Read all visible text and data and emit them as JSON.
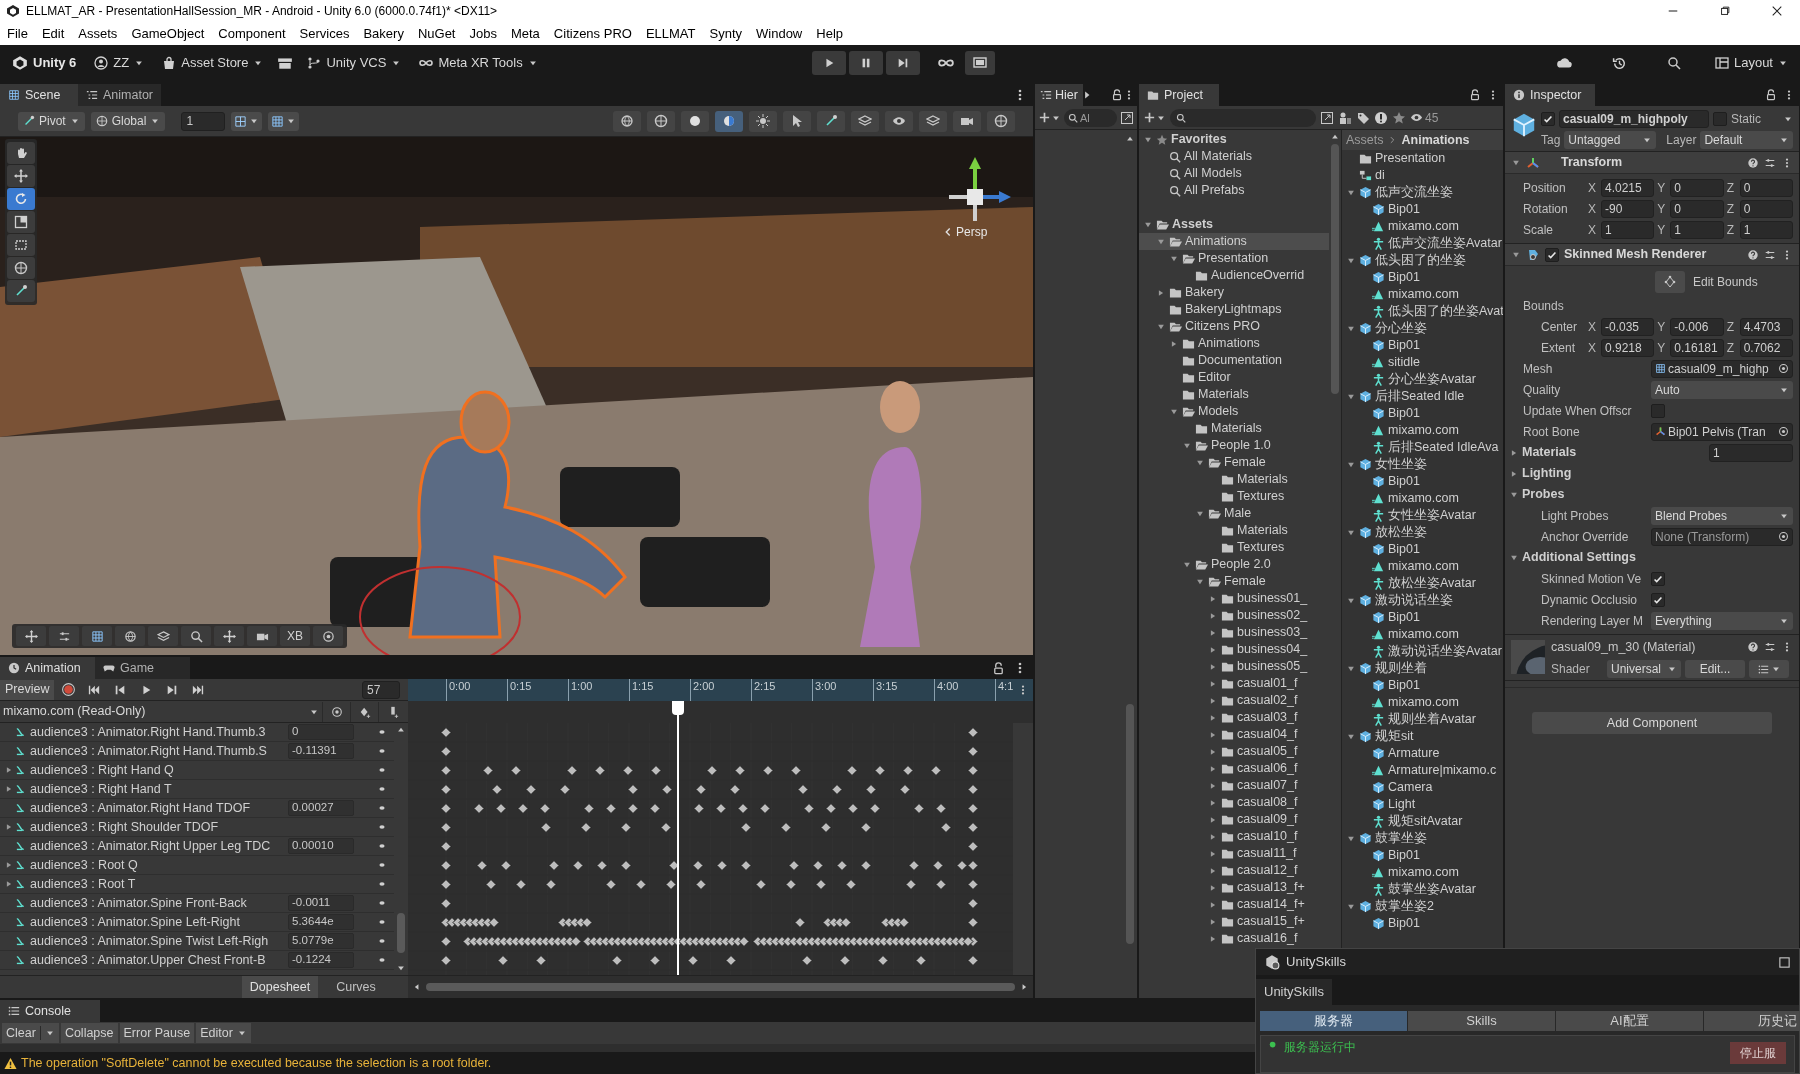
{
  "window": {
    "title": "ELLMAT_AR - PresentationHallSession_MR - Android - Unity 6.0 (6000.0.74f1)* <DX11>"
  },
  "menu": [
    "File",
    "Edit",
    "Assets",
    "GameObject",
    "Component",
    "Services",
    "Bakery",
    "NuGet",
    "Jobs",
    "Meta",
    "Citizens PRO",
    "ELLMAT",
    "Synty",
    "Window",
    "Help"
  ],
  "toolbar": {
    "product": "Unity 6",
    "account": "ZZ",
    "asset_store": "Asset Store",
    "vcs": "Unity VCS",
    "meta": "Meta XR Tools",
    "layout": "Layout"
  },
  "scene": {
    "tabs": [
      {
        "label": "Scene",
        "selected": true
      },
      {
        "label": "Animator",
        "selected": false
      }
    ],
    "pivot": "Pivot",
    "space": "Global",
    "grid_value": "1",
    "projection": "Persp",
    "overlay_label": "XB",
    "tools": [
      {
        "kind": "view",
        "selected": false
      },
      {
        "kind": "move",
        "selected": false
      },
      {
        "kind": "rotate",
        "selected": true
      },
      {
        "kind": "scale",
        "selected": false
      },
      {
        "kind": "rect",
        "selected": false
      },
      {
        "kind": "transform",
        "selected": false
      },
      {
        "kind": "custom",
        "selected": false
      }
    ]
  },
  "animation": {
    "tabs": [
      {
        "label": "Animation",
        "selected": true
      },
      {
        "label": "Game",
        "selected": false
      }
    ],
    "preview": "Preview",
    "frame": "57",
    "clip": "mixamo.com (Read-Only)",
    "ticks": [
      "0:00",
      "0:15",
      "1:00",
      "1:15",
      "2:00",
      "2:15",
      "3:00",
      "3:15",
      "4:00",
      "4:1"
    ],
    "properties": [
      {
        "name": "audience3 : Animator.Right Hand.Thumb.3",
        "value": "0",
        "expandable": false
      },
      {
        "name": "audience3 : Animator.Right Hand.Thumb.S",
        "value": "-0.11391",
        "expandable": false
      },
      {
        "name": "audience3 : Right Hand Q",
        "expandable": true
      },
      {
        "name": "audience3 : Right Hand T",
        "expandable": true
      },
      {
        "name": "audience3 : Animator.Right Hand TDOF",
        "value": "0.00027",
        "expandable": false
      },
      {
        "name": "audience3 : Right Shoulder TDOF",
        "expandable": true
      },
      {
        "name": "audience3 : Animator.Right Upper Leg TDC",
        "value": "0.00010",
        "expandable": false
      },
      {
        "name": "audience3 : Root Q",
        "expandable": true
      },
      {
        "name": "audience3 : Root T",
        "expandable": true
      },
      {
        "name": "audience3 : Animator.Spine Front-Back",
        "value": "-0.0011",
        "expandable": false
      },
      {
        "name": "audience3 : Animator.Spine Left-Right",
        "value": "5.3644e",
        "expandable": false
      },
      {
        "name": "audience3 : Animator.Spine Twist Left-Righ",
        "value": "5.0779e",
        "expandable": false
      },
      {
        "name": "audience3 : Animator.Upper Chest Front-B",
        "value": "-0.1224",
        "expandable": false
      }
    ],
    "views": [
      {
        "label": "Dopesheet",
        "selected": true
      },
      {
        "label": "Curves",
        "selected": false
      }
    ]
  },
  "hierarchy": {
    "tab": "Hier",
    "search_placeholder": "Al"
  },
  "project": {
    "tab": "Project",
    "count": "45",
    "favorites": {
      "label": "Favorites",
      "expanded": true,
      "items": [
        "All Materials",
        "All Models",
        "All Prefabs"
      ]
    },
    "tree": [
      {
        "label": "Assets",
        "expanded": true,
        "selected": false,
        "children": [
          {
            "label": "Animations",
            "expanded": true,
            "selected": true,
            "children": [
              {
                "label": "Presentation",
                "expanded": true,
                "selected": false,
                "children": [
                  {
                    "label": "AudienceOverrid",
                    "selected": false
                  }
                ]
              }
            ]
          },
          {
            "label": "Bakery",
            "expanded": false,
            "selected": false
          },
          {
            "label": "BakeryLightmaps",
            "selected": false
          },
          {
            "label": "Citizens PRO",
            "expanded": true,
            "selected": false,
            "children": [
              {
                "label": "Animations",
                "expanded": false,
                "selected": false
              },
              {
                "label": "Documentation",
                "selected": false
              },
              {
                "label": "Editor",
                "selected": false
              },
              {
                "label": "Materials",
                "selected": false
              },
              {
                "label": "Models",
                "expanded": true,
                "selected": false,
                "children": [
                  {
                    "label": "Materials",
                    "selected": false
                  },
                  {
                    "label": "People 1.0",
                    "expanded": true,
                    "selected": false,
                    "children": [
                      {
                        "label": "Female",
                        "expanded": true,
                        "selected": false,
                        "children": [
                          {
                            "label": "Materials",
                            "selected": false
                          },
                          {
                            "label": "Textures",
                            "selected": false
                          }
                        ]
                      },
                      {
                        "label": "Male",
                        "expanded": true,
                        "selected": false,
                        "children": [
                          {
                            "label": "Materials",
                            "selected": false
                          },
                          {
                            "label": "Textures",
                            "selected": false
                          }
                        ]
                      }
                    ]
                  },
                  {
                    "label": "People 2.0",
                    "expanded": true,
                    "selected": false,
                    "children": [
                      {
                        "label": "Female",
                        "expanded": true,
                        "selected": false,
                        "children": [
                          {
                            "label": "business01_",
                            "expanded": false,
                            "selected": false
                          },
                          {
                            "label": "business02_",
                            "expanded": false,
                            "selected": false
                          },
                          {
                            "label": "business03_",
                            "expanded": false,
                            "selected": false
                          },
                          {
                            "label": "business04_",
                            "expanded": false,
                            "selected": false
                          },
                          {
                            "label": "business05_",
                            "expanded": false,
                            "selected": false
                          },
                          {
                            "label": "casual01_f",
                            "expanded": false,
                            "selected": false
                          },
                          {
                            "label": "casual02_f",
                            "expanded": false,
                            "selected": false
                          },
                          {
                            "label": "casual03_f",
                            "expanded": false,
                            "selected": false
                          },
                          {
                            "label": "casual04_f",
                            "expanded": false,
                            "selected": false
                          },
                          {
                            "label": "casual05_f",
                            "expanded": false,
                            "selected": false
                          },
                          {
                            "label": "casual06_f",
                            "expanded": false,
                            "selected": false
                          },
                          {
                            "label": "casual07_f",
                            "expanded": false,
                            "selected": false
                          },
                          {
                            "label": "casual08_f",
                            "expanded": false,
                            "selected": false
                          },
                          {
                            "label": "casual09_f",
                            "expanded": false,
                            "selected": false
                          },
                          {
                            "label": "casual10_f",
                            "expanded": false,
                            "selected": false
                          },
                          {
                            "label": "casual11_f",
                            "expanded": false,
                            "selected": false
                          },
                          {
                            "label": "casual12_f",
                            "expanded": false,
                            "selected": false
                          },
                          {
                            "label": "casual13_f+",
                            "expanded": false,
                            "selected": false
                          },
                          {
                            "label": "casual14_f+",
                            "expanded": false,
                            "selected": false
                          },
                          {
                            "label": "casual15_f+",
                            "expanded": false,
                            "selected": false
                          },
                          {
                            "label": "casual16_f",
                            "expanded": false,
                            "selected": false
                          }
                        ]
                      }
                    ]
                  }
                ]
              }
            ]
          }
        ]
      }
    ],
    "breadcrumb": [
      "Assets",
      "Animations"
    ],
    "assets": [
      {
        "label": "Presentation",
        "kind": "folder"
      },
      {
        "label": "di",
        "kind": "controller"
      },
      {
        "label": "低声交流坐姿",
        "kind": "model",
        "expanded": true,
        "children": [
          {
            "label": "Bip01",
            "kind": "model"
          },
          {
            "label": "mixamo.com",
            "kind": "clip"
          },
          {
            "label": "低声交流坐姿Avatar",
            "kind": "avatar"
          }
        ]
      },
      {
        "label": "低头困了的坐姿",
        "kind": "model",
        "expanded": true,
        "children": [
          {
            "label": "Bip01",
            "kind": "model"
          },
          {
            "label": "mixamo.com",
            "kind": "clip"
          },
          {
            "label": "低头困了的坐姿Avat",
            "kind": "avatar"
          }
        ]
      },
      {
        "label": "分心坐姿",
        "kind": "model",
        "expanded": true,
        "children": [
          {
            "label": "Bip01",
            "kind": "model"
          },
          {
            "label": "sitidle",
            "kind": "clip"
          },
          {
            "label": "分心坐姿Avatar",
            "kind": "avatar"
          }
        ]
      },
      {
        "label": "后排Seated Idle",
        "kind": "model",
        "expanded": true,
        "children": [
          {
            "label": "Bip01",
            "kind": "model"
          },
          {
            "label": "mixamo.com",
            "kind": "clip"
          },
          {
            "label": "后排Seated IdleAva",
            "kind": "avatar"
          }
        ]
      },
      {
        "label": "女性坐姿",
        "kind": "model",
        "expanded": true,
        "children": [
          {
            "label": "Bip01",
            "kind": "model"
          },
          {
            "label": "mixamo.com",
            "kind": "clip"
          },
          {
            "label": "女性坐姿Avatar",
            "kind": "avatar"
          }
        ]
      },
      {
        "label": "放松坐姿",
        "kind": "model",
        "expanded": true,
        "children": [
          {
            "label": "Bip01",
            "kind": "model"
          },
          {
            "label": "mixamo.com",
            "kind": "clip"
          },
          {
            "label": "放松坐姿Avatar",
            "kind": "avatar"
          }
        ]
      },
      {
        "label": "激动说话坐姿",
        "kind": "model",
        "expanded": true,
        "children": [
          {
            "label": "Bip01",
            "kind": "model"
          },
          {
            "label": "mixamo.com",
            "kind": "clip"
          },
          {
            "label": "激动说话坐姿Avatar",
            "kind": "avatar"
          }
        ]
      },
      {
        "label": "规则坐着",
        "kind": "model",
        "expanded": true,
        "children": [
          {
            "label": "Bip01",
            "kind": "model"
          },
          {
            "label": "mixamo.com",
            "kind": "clip"
          },
          {
            "label": "规则坐着Avatar",
            "kind": "avatar"
          }
        ]
      },
      {
        "label": "规矩sit",
        "kind": "model",
        "expanded": true,
        "children": [
          {
            "label": "Armature",
            "kind": "model"
          },
          {
            "label": "Armature|mixamo.c",
            "kind": "clip"
          },
          {
            "label": "Camera",
            "kind": "model"
          },
          {
            "label": "Light",
            "kind": "model"
          },
          {
            "label": "规矩sitAvatar",
            "kind": "avatar"
          }
        ]
      },
      {
        "label": "鼓掌坐姿",
        "kind": "model",
        "expanded": true,
        "children": [
          {
            "label": "Bip01",
            "kind": "model"
          },
          {
            "label": "mixamo.com",
            "kind": "clip"
          },
          {
            "label": "鼓掌坐姿Avatar",
            "kind": "avatar"
          }
        ]
      },
      {
        "label": "鼓掌坐姿2",
        "kind": "model",
        "expanded": true,
        "children": [
          {
            "label": "Bip01",
            "kind": "model"
          }
        ]
      }
    ]
  },
  "inspector": {
    "tab": "Inspector",
    "object": {
      "name": "casual09_m_highpoly",
      "active": true,
      "static": false,
      "static_label": "Static",
      "tag_label": "Tag",
      "tag": "Untagged",
      "layer_label": "Layer",
      "layer": "Default"
    },
    "transform": {
      "title": "Transform",
      "expanded": true,
      "rows": [
        {
          "label": "Position",
          "fields": [
            {
              "axis": "X",
              "value": "4.0215"
            },
            {
              "axis": "Y",
              "value": "0"
            },
            {
              "axis": "Z",
              "value": "0"
            }
          ]
        },
        {
          "label": "Rotation",
          "fields": [
            {
              "axis": "X",
              "value": "-90"
            },
            {
              "axis": "Y",
              "value": "0"
            },
            {
              "axis": "Z",
              "value": "0"
            }
          ]
        },
        {
          "label": "Scale",
          "fields": [
            {
              "axis": "X",
              "value": "1"
            },
            {
              "axis": "Y",
              "value": "1"
            },
            {
              "axis": "Z",
              "value": "1"
            }
          ]
        }
      ]
    },
    "skinned_mesh_renderer": {
      "title": "Skinned Mesh Renderer",
      "enabled": true,
      "expanded": true,
      "edit_bounds": "Edit Bounds",
      "bounds_label": "Bounds",
      "bounds": [
        {
          "label": "Center",
          "fields": [
            {
              "axis": "X",
              "value": "-0.035"
            },
            {
              "axis": "Y",
              "value": "-0.006"
            },
            {
              "axis": "Z",
              "value": "4.4703"
            }
          ]
        },
        {
          "label": "Extent",
          "fields": [
            {
              "axis": "X",
              "value": "0.9218"
            },
            {
              "axis": "Y",
              "value": "0.16181"
            },
            {
              "axis": "Z",
              "value": "0.7062"
            }
          ]
        }
      ],
      "properties": [
        {
          "kind": "object",
          "label": "Mesh",
          "value": "casual09_m_highp"
        },
        {
          "kind": "dropdown",
          "label": "Quality",
          "value": "Auto"
        },
        {
          "kind": "checkbox",
          "label": "Update When Offscr",
          "checked": false
        },
        {
          "kind": "object",
          "label": "Root Bone",
          "value": "Bip01 Pelvis (Tran"
        },
        {
          "kind": "foldout",
          "label": "Materials",
          "expanded": false,
          "value": "1"
        },
        {
          "kind": "foldout",
          "label": "Lighting",
          "expanded": false
        },
        {
          "kind": "foldout",
          "label": "Probes",
          "expanded": true,
          "children": [
            {
              "kind": "dropdown",
              "label": "Light Probes",
              "value": "Blend Probes"
            },
            {
              "kind": "reference",
              "label": "Anchor Override",
              "value": "None (Transform)"
            }
          ]
        },
        {
          "kind": "foldout",
          "label": "Additional Settings",
          "expanded": true,
          "children": [
            {
              "kind": "checkbox",
              "label": "Skinned Motion Ve",
              "checked": true
            },
            {
              "kind": "checkbox",
              "label": "Dynamic Occlusio",
              "checked": true
            },
            {
              "kind": "dropdown",
              "label": "Rendering Layer M",
              "value": "Everything"
            }
          ]
        }
      ]
    },
    "material": {
      "name": "casual09_m_30 (Material)",
      "shader_label": "Shader",
      "shader": "Universal",
      "edit": "Edit..."
    },
    "add_component": "Add Component"
  },
  "console": {
    "tab": "Console",
    "buttons": [
      {
        "label": "Clear",
        "kind": "split"
      },
      {
        "label": "Collapse",
        "kind": "toggle"
      },
      {
        "label": "Error Pause",
        "kind": "toggle"
      },
      {
        "label": "Editor",
        "kind": "dropdown"
      }
    ],
    "status": "The operation \"SoftDelete\" cannot be executed because the selection is a root folder."
  },
  "unityskills": {
    "title": "UnitySkills",
    "tab": "UnitySkills",
    "sections": [
      {
        "label": "服务器",
        "selected": true
      },
      {
        "label": "Skills",
        "selected": false
      },
      {
        "label": "AI配置",
        "selected": false
      },
      {
        "label": "历史记",
        "selected": false
      }
    ],
    "status": "服务器运行中",
    "stop_button": "停止服"
  }
}
